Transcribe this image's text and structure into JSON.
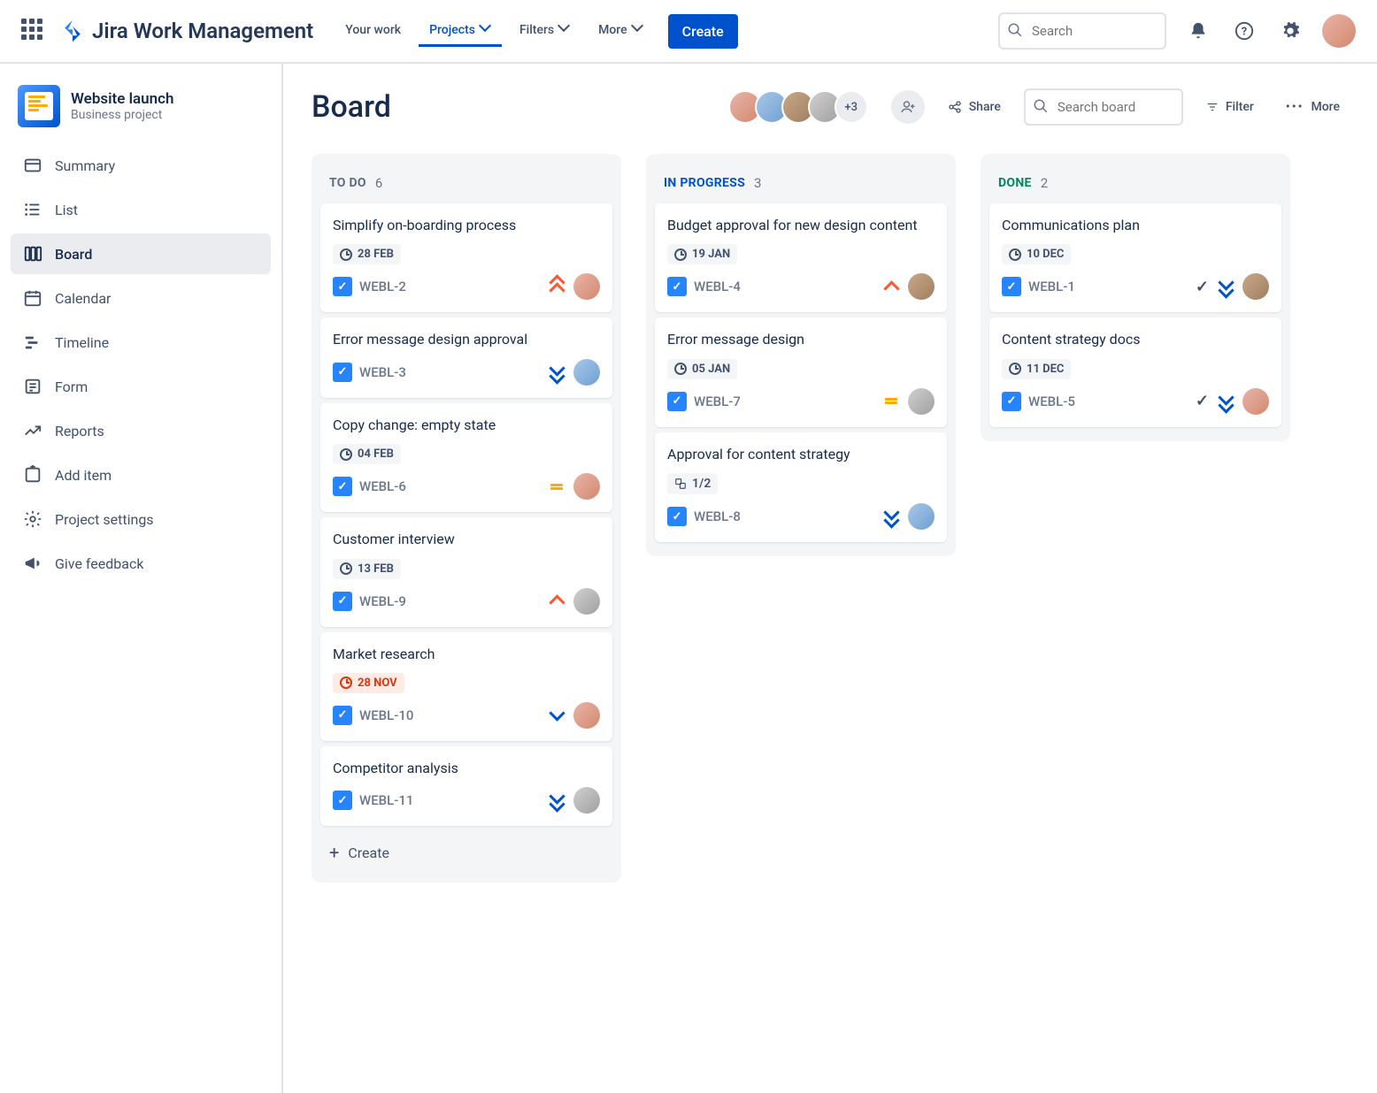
{
  "topnav": {
    "product": "Jira Work Management",
    "links": {
      "your_work": "Your work",
      "projects": "Projects",
      "filters": "Filters",
      "more": "More"
    },
    "create": "Create",
    "search_placeholder": "Search"
  },
  "project": {
    "name": "Website launch",
    "type": "Business project"
  },
  "sidebar": {
    "summary": "Summary",
    "list": "List",
    "board": "Board",
    "calendar": "Calendar",
    "timeline": "Timeline",
    "form": "Form",
    "reports": "Reports",
    "add_item": "Add item",
    "settings": "Project settings",
    "feedback": "Give feedback"
  },
  "board": {
    "title": "Board",
    "avatar_overflow": "+3",
    "share": "Share",
    "search_placeholder": "Search board",
    "filter": "Filter",
    "more": "More",
    "create_card": "Create"
  },
  "columns": {
    "todo": {
      "title": "TO DO",
      "count": "6"
    },
    "in_progress": {
      "title": "IN PROGRESS",
      "count": "3"
    },
    "done": {
      "title": "DONE",
      "count": "2"
    }
  },
  "cards": {
    "todo": [
      {
        "title": "Simplify on-boarding process",
        "date": "28 FEB",
        "key": "WEBL-2",
        "priority": "highest",
        "assignee": "a1"
      },
      {
        "title": "Error message design approval",
        "key": "WEBL-3",
        "priority": "lowest",
        "assignee": "a2"
      },
      {
        "title": "Copy change: empty state",
        "date": "04 FEB",
        "key": "WEBL-6",
        "priority": "medium",
        "assignee": "a1"
      },
      {
        "title": "Customer interview",
        "date": "13 FEB",
        "key": "WEBL-9",
        "priority": "high",
        "assignee": "a4"
      },
      {
        "title": "Market research",
        "date": "28 NOV",
        "overdue": true,
        "key": "WEBL-10",
        "priority": "low",
        "assignee": "a1"
      },
      {
        "title": "Competitor analysis",
        "key": "WEBL-11",
        "priority": "lowest",
        "assignee": "a4"
      }
    ],
    "in_progress": [
      {
        "title": "Budget approval for new design content",
        "date": "19 JAN",
        "key": "WEBL-4",
        "priority": "high",
        "assignee": "a3"
      },
      {
        "title": "Error message design",
        "date": "05 JAN",
        "key": "WEBL-7",
        "priority": "medium",
        "assignee": "a4"
      },
      {
        "title": "Approval for content strategy",
        "subtasks": "1/2",
        "key": "WEBL-8",
        "priority": "lowest",
        "assignee": "a2"
      }
    ],
    "done": [
      {
        "title": "Communications plan",
        "date": "10 DEC",
        "key": "WEBL-1",
        "done": true,
        "priority": "lowest",
        "assignee": "a3"
      },
      {
        "title": "Content strategy docs",
        "date": "11 DEC",
        "key": "WEBL-5",
        "done": true,
        "priority": "lowest",
        "assignee": "a1"
      }
    ]
  }
}
